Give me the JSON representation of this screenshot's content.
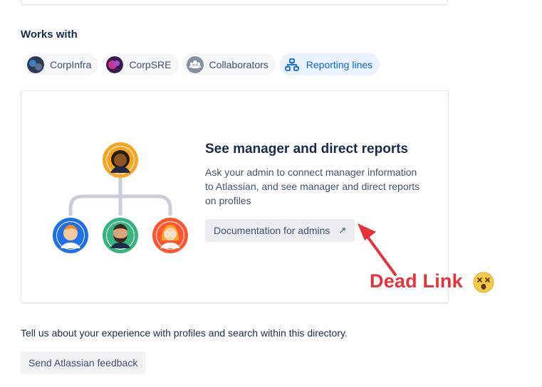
{
  "works_with": {
    "title": "Works with",
    "chips": [
      {
        "label": "CorpInfra",
        "icon": "team-avatar-icon",
        "active": false
      },
      {
        "label": "CorpSRE",
        "icon": "team-avatar-icon",
        "active": false
      },
      {
        "label": "Collaborators",
        "icon": "people-icon",
        "active": false
      },
      {
        "label": "Reporting lines",
        "icon": "hierarchy-icon",
        "active": true
      }
    ]
  },
  "reporting_panel": {
    "heading": "See manager and direct reports",
    "description": "Ask your admin to connect manager information to Atlassian, and see manager and direct reports on profiles",
    "doc_button_label": "Documentation for admins",
    "doc_button_icon": "↗"
  },
  "annotation": {
    "text": "Dead Link",
    "emoji": "dizzy-face-emoji",
    "color": "#e8323a"
  },
  "feedback": {
    "prompt": "Tell us about your experience with profiles and search within this directory.",
    "button_label": "Send Atlassian feedback"
  },
  "colors": {
    "accent": "#0c66e4",
    "chip_bg": "#f4f5f7",
    "active_chip_bg": "#e9f2ff"
  }
}
